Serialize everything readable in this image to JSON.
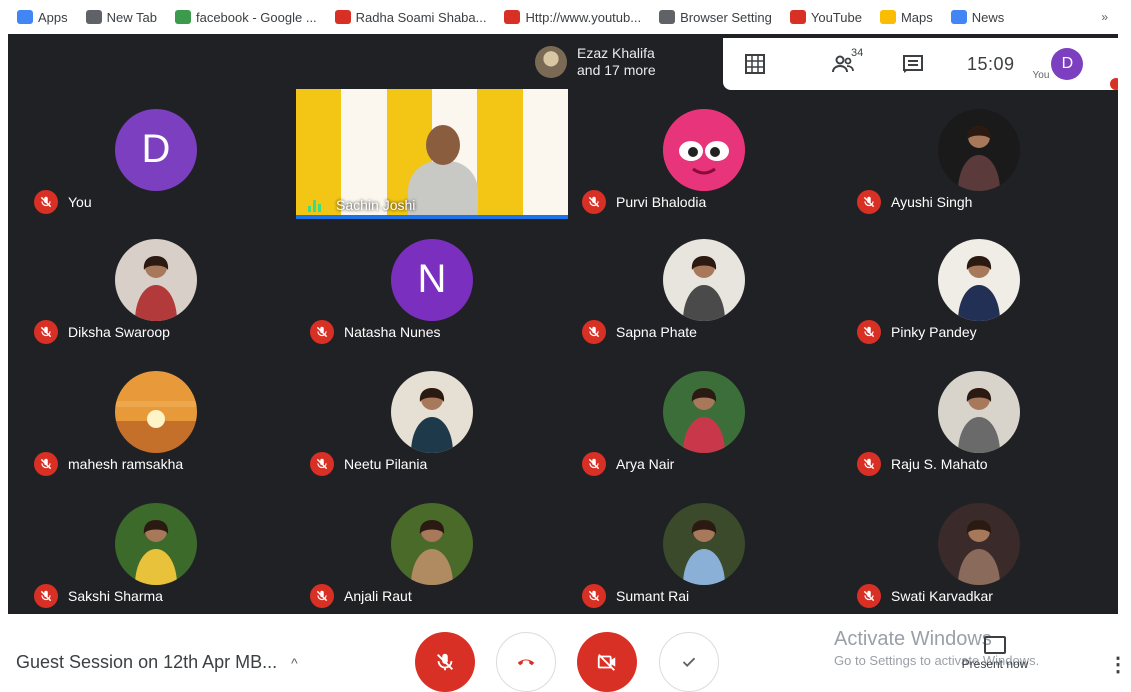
{
  "bookmarks": [
    {
      "label": "Apps",
      "color": "#4285f4"
    },
    {
      "label": "New Tab",
      "color": "#5f6368"
    },
    {
      "label": "facebook - Google ...",
      "color": "#3b9a4b"
    },
    {
      "label": "Radha Soami Shaba...",
      "color": "#d93025"
    },
    {
      "label": "Http://www.youtub...",
      "color": "#d93025"
    },
    {
      "label": "Browser Setting",
      "color": "#5f6368"
    },
    {
      "label": "YouTube",
      "color": "#d93025"
    },
    {
      "label": "Maps",
      "color": "#fbbc04"
    },
    {
      "label": "News",
      "color": "#4285f4"
    }
  ],
  "bookmarks_more": "»",
  "top": {
    "participants_chip_line1": "Ezaz Khalifa",
    "participants_chip_line2": "and 17 more",
    "people_count": "34",
    "clock": "15:09",
    "you_label": "You",
    "me_initial": "D"
  },
  "tiles": [
    {
      "name": "You",
      "avatar": "letter",
      "letter": "D",
      "color": "#7b3fbf"
    },
    {
      "name": "Purvi Bhalodia",
      "avatar": "cartoon"
    },
    {
      "name": "Ayushi Singh",
      "avatar": "photo",
      "tone": "dark"
    },
    {
      "name": "Diksha Swaroop",
      "avatar": "photo",
      "tone": "red"
    },
    {
      "name": "Natasha Nunes",
      "avatar": "letter",
      "letter": "N",
      "color": "#7b2fbf"
    },
    {
      "name": "Sapna Phate",
      "avatar": "photo",
      "tone": "light"
    },
    {
      "name": "Pinky Pandey",
      "avatar": "photo",
      "tone": "navy"
    },
    {
      "name": "mahesh ramsakha",
      "avatar": "sunset"
    },
    {
      "name": "Neetu Pilania",
      "avatar": "photo",
      "tone": "teal"
    },
    {
      "name": "Arya Nair",
      "avatar": "photo",
      "tone": "redwall"
    },
    {
      "name": "Raju S. Mahato",
      "avatar": "photo",
      "tone": "grey"
    },
    {
      "name": "Sakshi Sharma",
      "avatar": "photo",
      "tone": "yellow"
    },
    {
      "name": "Anjali Raut",
      "avatar": "photo",
      "tone": "green"
    },
    {
      "name": "Sumant Rai",
      "avatar": "photo",
      "tone": "blue"
    },
    {
      "name": "Swati Karvadkar",
      "avatar": "photo",
      "tone": "brown"
    }
  ],
  "video_tile": {
    "name": "Sachin Joshi"
  },
  "bottom": {
    "meeting_title": "Guest Session on 12th Apr MB...",
    "title_chevron": "^",
    "activate_line1": "Activate Windows",
    "activate_line2": "Go to Settings to activate Windows.",
    "present_label": "Present now",
    "more": "⋮"
  }
}
